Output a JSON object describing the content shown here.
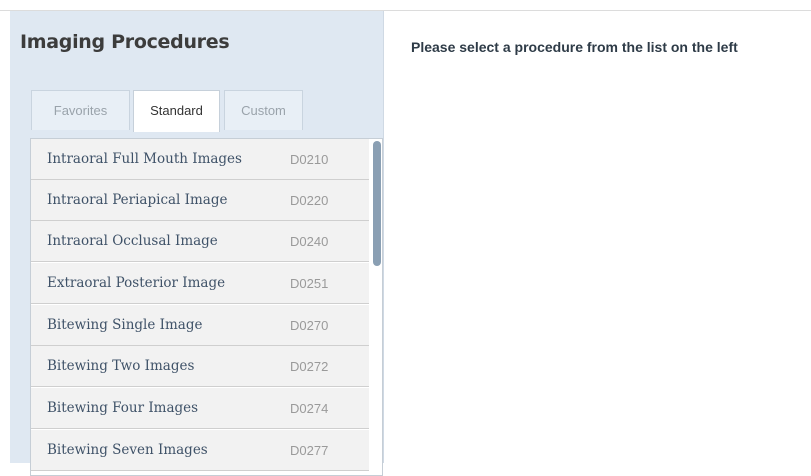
{
  "panel": {
    "title": "Imaging Procedures"
  },
  "tabs": [
    {
      "label": "Favorites",
      "active": false
    },
    {
      "label": "Standard",
      "active": true
    },
    {
      "label": "Custom",
      "active": false
    }
  ],
  "procedures": [
    {
      "name": "Intraoral Full Mouth Images",
      "code": "D0210"
    },
    {
      "name": "Intraoral Periapical Image",
      "code": "D0220"
    },
    {
      "name": "Intraoral Occlusal Image",
      "code": "D0240"
    },
    {
      "name": "Extraoral Posterior Image",
      "code": "D0251"
    },
    {
      "name": "Bitewing Single Image",
      "code": "D0270"
    },
    {
      "name": "Bitewing Two Images",
      "code": "D0272"
    },
    {
      "name": "Bitewing Four Images",
      "code": "D0274"
    },
    {
      "name": "Bitewing Seven Images",
      "code": "D0277"
    }
  ],
  "main": {
    "message": "Please select a procedure from the list on the left"
  },
  "colors": {
    "panel_bg": "#dfe8f2",
    "item_text": "#3f5268",
    "scroll_thumb": "#8a9fb3"
  }
}
